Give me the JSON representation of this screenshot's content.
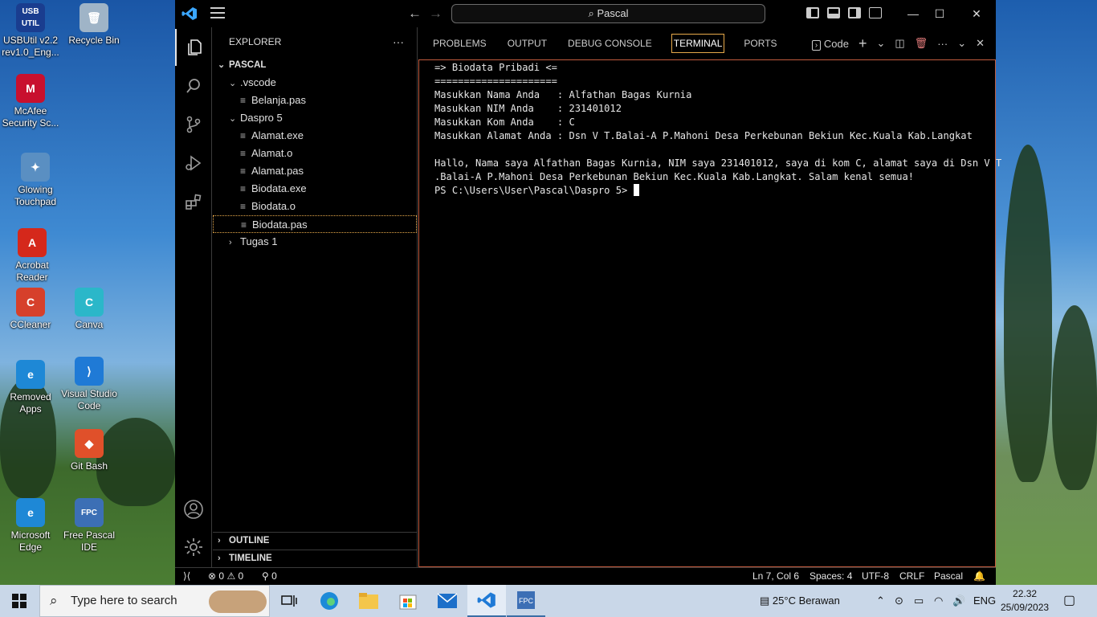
{
  "desktop": {
    "icons": [
      {
        "label": "USBUtil v2.2 rev1.0_Eng...",
        "icon": "usbutil-icon",
        "glyph": "USB UTIL",
        "color": "#1a3d8f"
      },
      {
        "label": "Recycle Bin",
        "icon": "recycle-bin-icon",
        "glyph": "🗑",
        "color": "#9fb4c7"
      },
      {
        "label": "McAfee Security Sc...",
        "icon": "mcafee-icon",
        "glyph": "M",
        "color": "#c8102e"
      },
      {
        "label": "Glowing Touchpad",
        "icon": "touchpad-icon",
        "glyph": "✦",
        "color": "#5a8fc2"
      },
      {
        "label": "Acrobat Reader",
        "icon": "acrobat-icon",
        "glyph": "A",
        "color": "#d5281b"
      },
      {
        "label": "CCleaner",
        "icon": "ccleaner-icon",
        "glyph": "C",
        "color": "#d6402b"
      },
      {
        "label": "Canva",
        "icon": "canva-icon",
        "glyph": "C",
        "color": "#2bb7c9"
      },
      {
        "label": "Removed Apps",
        "icon": "edge-icon",
        "glyph": "e",
        "color": "#1e88d6"
      },
      {
        "label": "Visual Studio Code",
        "icon": "vscode-icon",
        "glyph": "⟩",
        "color": "#1f7ad6"
      },
      {
        "label": "Git Bash",
        "icon": "git-bash-icon",
        "glyph": "◆",
        "color": "#e0502a"
      },
      {
        "label": "Microsoft Edge",
        "icon": "edge-icon",
        "glyph": "e",
        "color": "#1e88d6"
      },
      {
        "label": "Free Pascal IDE",
        "icon": "free-pascal-icon",
        "glyph": "FPC",
        "color": "#3c6fb5"
      }
    ]
  },
  "window": {
    "search_label": "Pascal",
    "controls": {
      "minimize": "—",
      "maximize": "☐",
      "close": "✕"
    }
  },
  "explorer": {
    "title": "EXPLORER",
    "more": "···",
    "root": "PASCAL",
    "tree": [
      {
        "label": ".vscode",
        "type": "folder",
        "expanded": true,
        "depth": 1
      },
      {
        "label": "Belanja.pas",
        "type": "file",
        "depth": 2
      },
      {
        "label": "Daspro 5",
        "type": "folder",
        "expanded": true,
        "depth": 1
      },
      {
        "label": "Alamat.exe",
        "type": "file",
        "depth": 2
      },
      {
        "label": "Alamat.o",
        "type": "file",
        "depth": 2
      },
      {
        "label": "Alamat.pas",
        "type": "file",
        "depth": 2
      },
      {
        "label": "Biodata.exe",
        "type": "file",
        "depth": 2
      },
      {
        "label": "Biodata.o",
        "type": "file",
        "depth": 2
      },
      {
        "label": "Biodata.pas",
        "type": "file",
        "depth": 2,
        "selected": true
      },
      {
        "label": "Tugas 1",
        "type": "folder",
        "expanded": false,
        "depth": 1
      }
    ],
    "outline": "OUTLINE",
    "timeline": "TIMELINE"
  },
  "panel": {
    "tabs": [
      "PROBLEMS",
      "OUTPUT",
      "DEBUG CONSOLE",
      "TERMINAL",
      "PORTS"
    ],
    "active_tab": "TERMINAL",
    "terminal_profile": "Code",
    "terminal_lines": [
      "=> Biodata Pribadi <=",
      "=====================",
      "Masukkan Nama Anda   : Alfathan Bagas Kurnia",
      "Masukkan NIM Anda    : 231401012",
      "Masukkan Kom Anda    : C",
      "Masukkan Alamat Anda : Dsn V T.Balai-A P.Mahoni Desa Perkebunan Bekiun Kec.Kuala Kab.Langkat",
      "",
      "Hallo, Nama saya Alfathan Bagas Kurnia, NIM saya 231401012, saya di kom C, alamat saya di Dsn V T",
      ".Balai-A P.Mahoni Desa Perkebunan Bekiun Kec.Kuala Kab.Langkat. Salam kenal semua!"
    ],
    "prompt": "PS C:\\Users\\User\\Pascal\\Daspro 5> "
  },
  "statusbar": {
    "errors": "0",
    "warnings": "0",
    "ports": "0",
    "position": "Ln 7, Col 6",
    "spaces": "Spaces: 4",
    "encoding": "UTF-8",
    "eol": "CRLF",
    "language": "Pascal"
  },
  "taskbar": {
    "search_placeholder": "Type here to search",
    "weather": "25°C  Berawan",
    "language": "ENG",
    "time": "22.32",
    "date": "25/09/2023",
    "accent": "#3a6ea5"
  }
}
